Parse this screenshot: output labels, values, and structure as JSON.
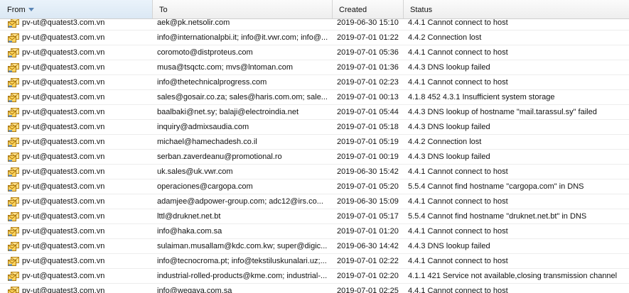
{
  "columns": {
    "from": "From",
    "to": "To",
    "created": "Created",
    "status": "Status"
  },
  "icon": "outbox-envelope-icon",
  "rows": [
    {
      "from": "pv-ut@quatest3.com.vn",
      "to": "aek@pk.netsolir.com",
      "created": "2019-06-30 15:10",
      "status": "4.4.1 Cannot connect to host"
    },
    {
      "from": "pv-ut@quatest3.com.vn",
      "to": "info@internationalpbi.it; info@it.vwr.com; info@...",
      "created": "2019-07-01 01:22",
      "status": "4.4.2 Connection lost"
    },
    {
      "from": "pv-ut@quatest3.com.vn",
      "to": "coromoto@distproteus.com",
      "created": "2019-07-01 05:36",
      "status": "4.4.1 Cannot connect to host"
    },
    {
      "from": "pv-ut@quatest3.com.vn",
      "to": "musa@tsqctc.com; mvs@lntoman.com",
      "created": "2019-07-01 01:36",
      "status": "4.4.3 DNS lookup failed"
    },
    {
      "from": "pv-ut@quatest3.com.vn",
      "to": "info@thetechnicalprogress.com",
      "created": "2019-07-01 02:23",
      "status": "4.4.1 Cannot connect to host"
    },
    {
      "from": "pv-ut@quatest3.com.vn",
      "to": "sales@gosair.co.za; sales@haris.com.om; sale...",
      "created": "2019-07-01 00:13",
      "status": "4.1.8 452 4.3.1 Insufficient system storage"
    },
    {
      "from": "pv-ut@quatest3.com.vn",
      "to": "baalbaki@net.sy; balaji@electroindia.net",
      "created": "2019-07-01 05:44",
      "status": "4.4.3 DNS lookup of hostname \"mail.tarassul.sy\" failed"
    },
    {
      "from": "pv-ut@quatest3.com.vn",
      "to": "inquiry@admixsaudia.com",
      "created": "2019-07-01 05:18",
      "status": "4.4.3 DNS lookup failed"
    },
    {
      "from": "pv-ut@quatest3.com.vn",
      "to": "michael@hamechadesh.co.il",
      "created": "2019-07-01 05:19",
      "status": "4.4.2 Connection lost"
    },
    {
      "from": "pv-ut@quatest3.com.vn",
      "to": "serban.zaverdeanu@promotional.ro",
      "created": "2019-07-01 00:19",
      "status": "4.4.3 DNS lookup failed"
    },
    {
      "from": "pv-ut@quatest3.com.vn",
      "to": "uk.sales@uk.vwr.com",
      "created": "2019-06-30 15:42",
      "status": "4.4.1 Cannot connect to host"
    },
    {
      "from": "pv-ut@quatest3.com.vn",
      "to": "operaciones@cargopa.com",
      "created": "2019-07-01 05:20",
      "status": "5.5.4 Cannot find hostname \"cargopa.com\" in DNS"
    },
    {
      "from": "pv-ut@quatest3.com.vn",
      "to": "adamjee@adpower-group.com; adc12@irs.co...",
      "created": "2019-06-30 15:09",
      "status": "4.4.1 Cannot connect to host"
    },
    {
      "from": "pv-ut@quatest3.com.vn",
      "to": "lttl@druknet.net.bt",
      "created": "2019-07-01 05:17",
      "status": "5.5.4 Cannot find hostname \"druknet.net.bt\" in DNS"
    },
    {
      "from": "pv-ut@quatest3.com.vn",
      "to": "info@haka.com.sa",
      "created": "2019-07-01 01:20",
      "status": "4.4.1 Cannot connect to host"
    },
    {
      "from": "pv-ut@quatest3.com.vn",
      "to": "sulaiman.musallam@kdc.com.kw; super@digic...",
      "created": "2019-06-30 14:42",
      "status": "4.4.3 DNS lookup failed"
    },
    {
      "from": "pv-ut@quatest3.com.vn",
      "to": "info@tecnocroma.pt; info@tekstiluskunalari.uz;...",
      "created": "2019-07-01 02:22",
      "status": "4.4.1 Cannot connect to host"
    },
    {
      "from": "pv-ut@quatest3.com.vn",
      "to": "industrial-rolled-products@kme.com; industrial-...",
      "created": "2019-07-01 02:20",
      "status": "4.1.1 421 Service not available,closing transmission channel"
    },
    {
      "from": "pv-ut@quatest3.com.vn",
      "to": "info@wegaya.com.sa",
      "created": "2019-07-01 02:25",
      "status": "4.4.1 Cannot connect to host"
    }
  ]
}
